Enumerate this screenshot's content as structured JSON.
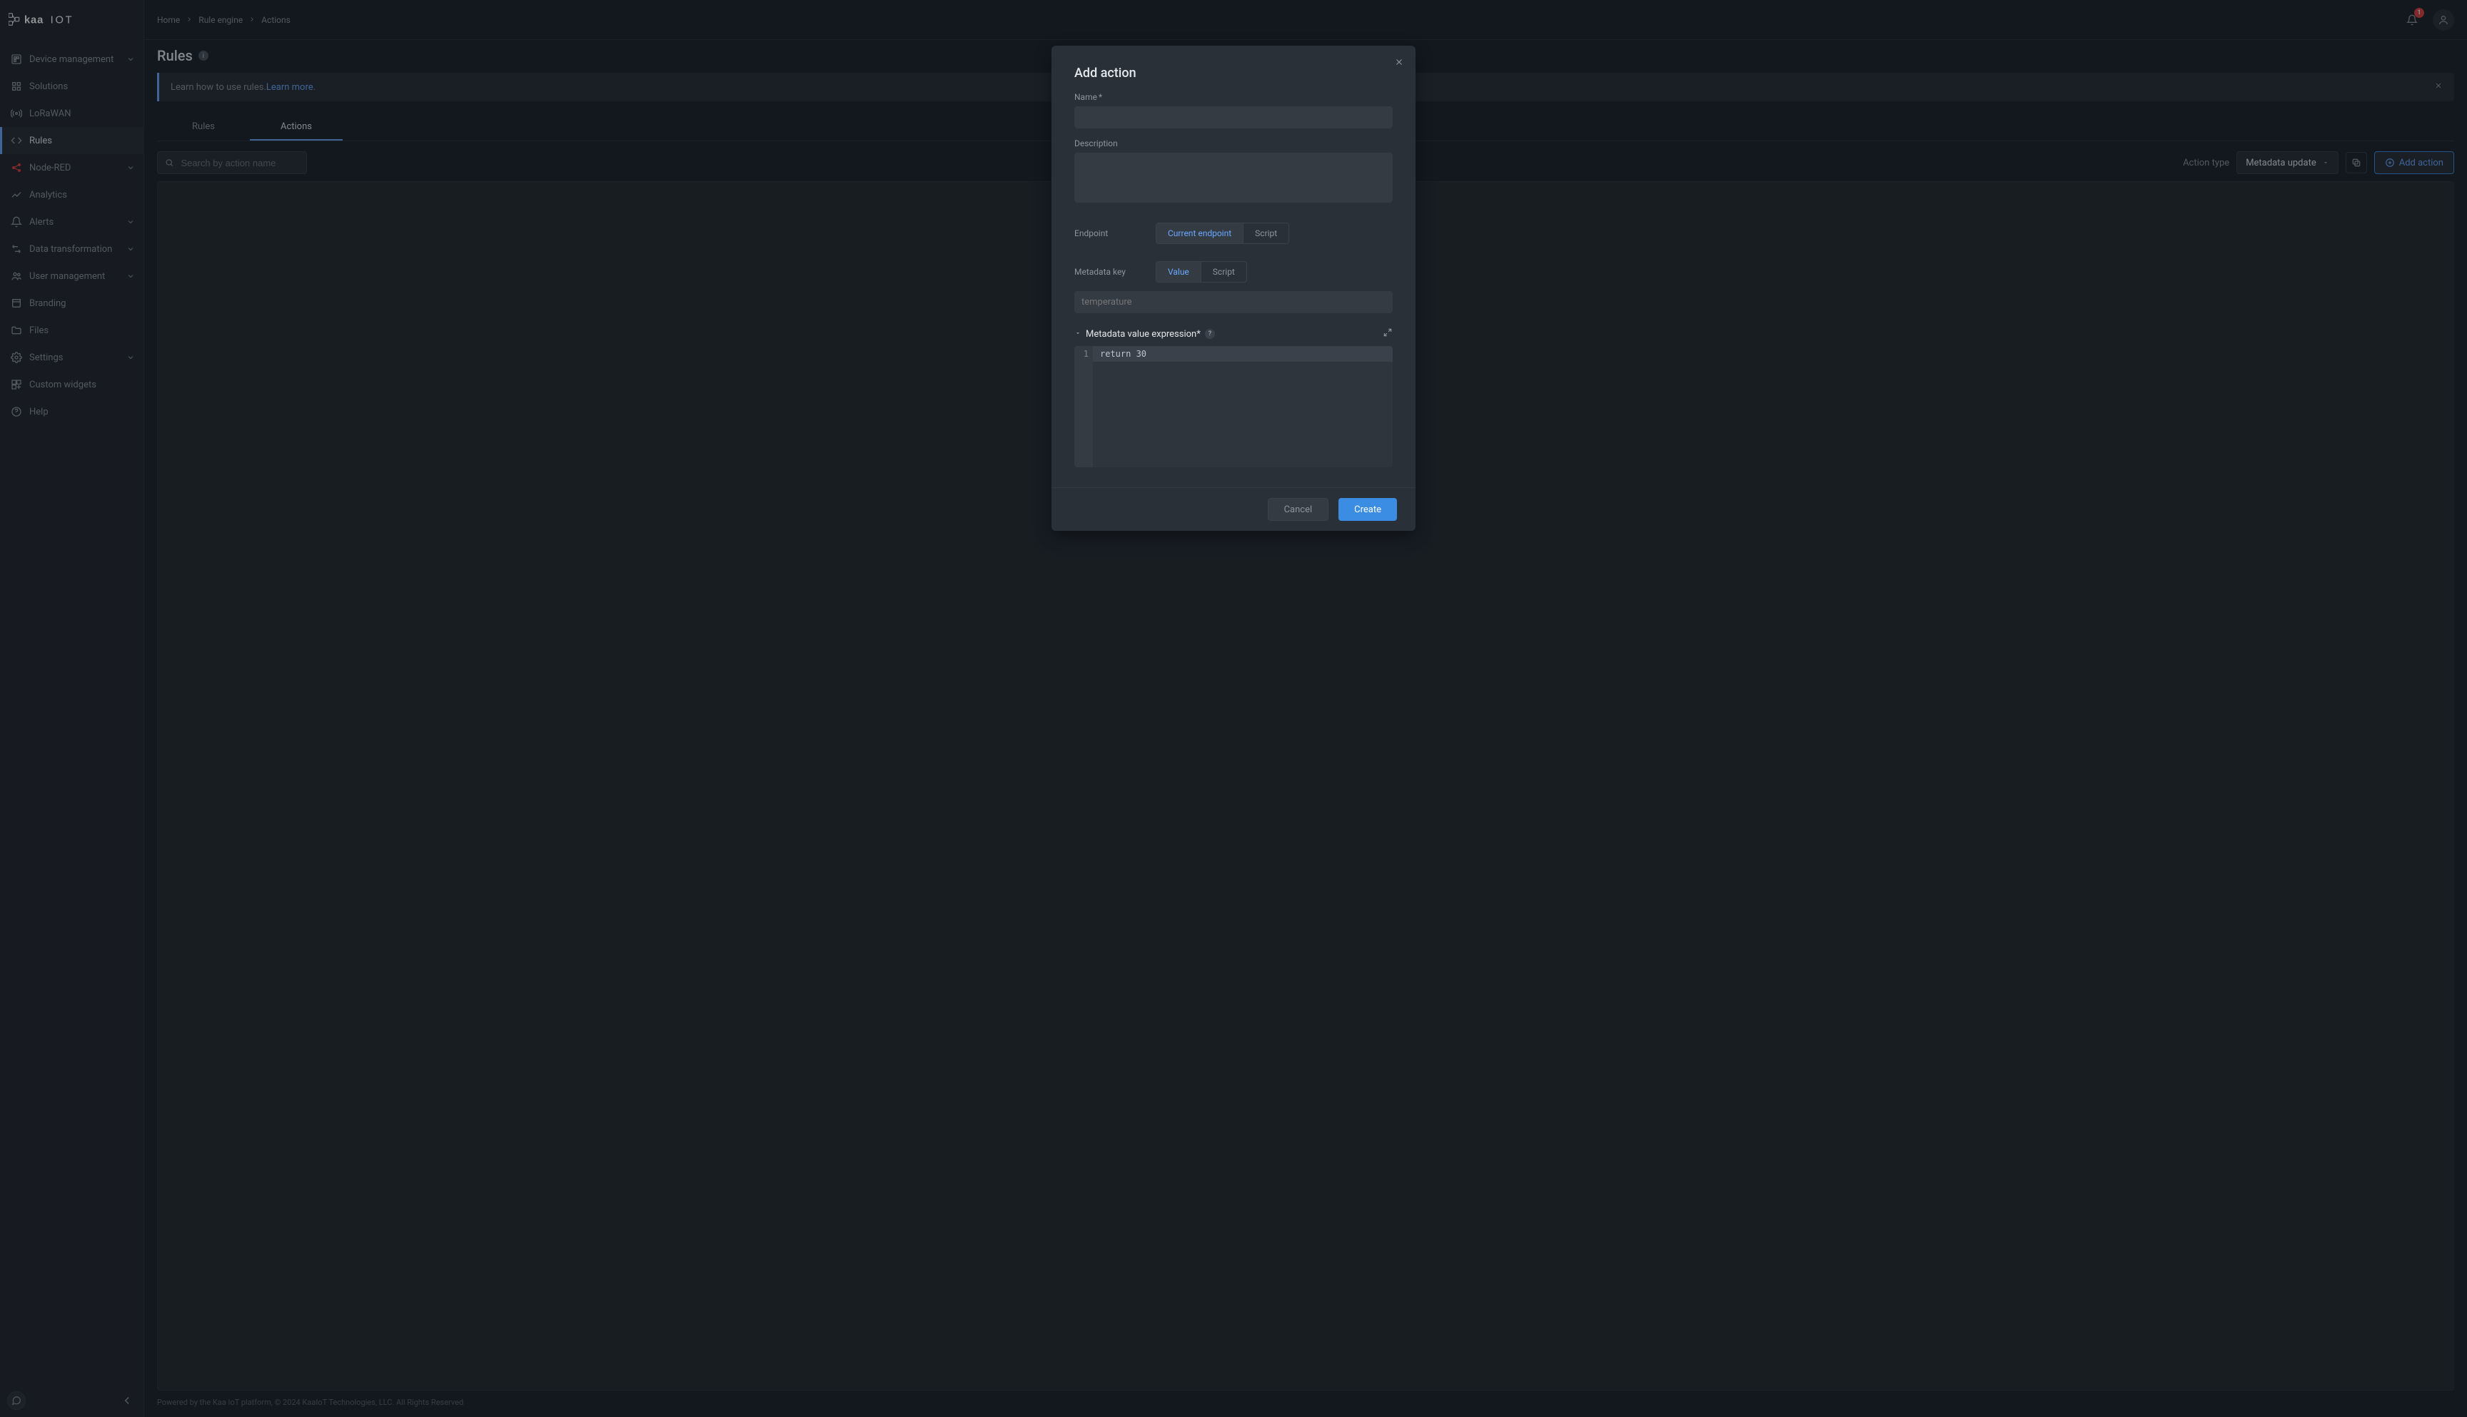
{
  "brand": {
    "name": "kaaiot"
  },
  "header": {
    "breadcrumbs": [
      "Home",
      "Rule engine",
      "Actions"
    ],
    "notifications": {
      "count": "1"
    }
  },
  "page": {
    "title": "Rules",
    "banner": {
      "prefix": "Learn how to use rules. ",
      "link": "Learn more",
      "suffix": "."
    }
  },
  "sidebar": {
    "items": [
      {
        "id": "device-management",
        "label": "Device management",
        "expandable": true
      },
      {
        "id": "solutions",
        "label": "Solutions"
      },
      {
        "id": "lorawan",
        "label": "LoRaWAN"
      },
      {
        "id": "rules",
        "label": "Rules",
        "active": true
      },
      {
        "id": "node-red",
        "label": "Node-RED",
        "expandable": true
      },
      {
        "id": "analytics",
        "label": "Analytics"
      },
      {
        "id": "alerts",
        "label": "Alerts",
        "expandable": true
      },
      {
        "id": "data-transformation",
        "label": "Data transformation",
        "expandable": true
      },
      {
        "id": "user-management",
        "label": "User management",
        "expandable": true
      },
      {
        "id": "branding",
        "label": "Branding"
      },
      {
        "id": "files",
        "label": "Files"
      },
      {
        "id": "settings",
        "label": "Settings",
        "expandable": true
      },
      {
        "id": "custom-widgets",
        "label": "Custom widgets"
      },
      {
        "id": "help",
        "label": "Help"
      }
    ]
  },
  "tabs": {
    "items": [
      "Rules",
      "Actions"
    ],
    "activeIndex": 1
  },
  "toolbar": {
    "search_placeholder": "Search by action name",
    "action_type_label": "Action type",
    "action_type_value": "Metadata update",
    "add_action_label": "Add action"
  },
  "modal": {
    "title": "Add action",
    "name_label": "Name",
    "required_mark": "*",
    "description_label": "Description",
    "endpoint_label": "Endpoint",
    "endpoint_options": [
      "Current endpoint",
      "Script"
    ],
    "endpoint_activeIndex": 0,
    "metadata_key_label": "Metadata key",
    "metadata_key_options": [
      "Value",
      "Script"
    ],
    "metadata_key_activeIndex": 0,
    "metadata_key_placeholder": "temperature",
    "expression_label": "Metadata value expression",
    "expression_required_mark": "*",
    "expression_help": "?",
    "code": {
      "gutter": [
        "1"
      ],
      "lines": [
        "return 30"
      ]
    },
    "cancel_label": "Cancel",
    "create_label": "Create"
  },
  "footer": {
    "text": "Powered by the Kaa IoT platform, © 2024 KaaIoT Technologies, LLC.  All Rights Reserved"
  }
}
